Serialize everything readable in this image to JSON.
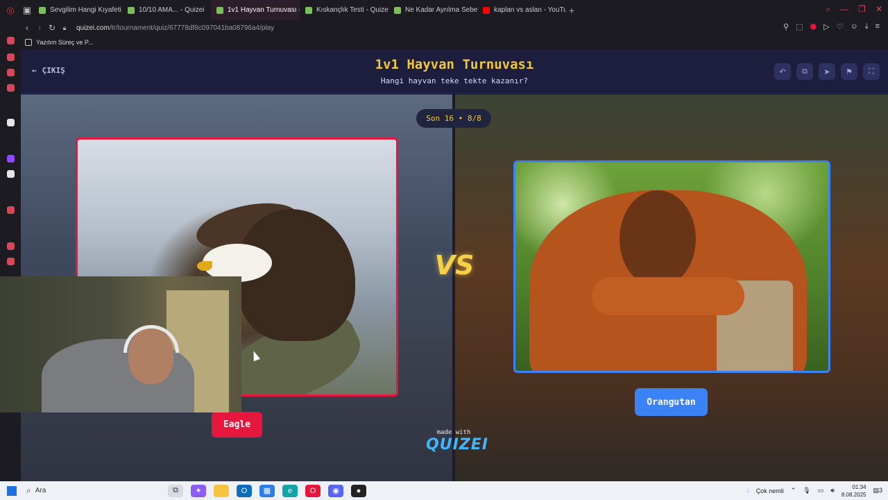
{
  "browser": {
    "tabs": [
      {
        "label": "Sevgilim Hangi Kıyafeti D",
        "color": "#7bbf5a",
        "active": false
      },
      {
        "label": "10/10 AMA... - Quizei",
        "color": "#7bbf5a",
        "active": false
      },
      {
        "label": "1v1 Hayvan Turnuvası - Q",
        "color": "#7bbf5a",
        "active": true
      },
      {
        "label": "Kıskançlık Testi - Quizei",
        "color": "#7bbf5a",
        "active": false
      },
      {
        "label": "Ne Kadar Ayrılma Sebebi",
        "color": "#7bbf5a",
        "active": false
      },
      {
        "label": "kaplan vs aslan - YouTube",
        "color": "#ff0000",
        "active": false
      }
    ],
    "url_host": "quizei.com",
    "url_path": "/tr/tournament/quiz/67778df8c097041ba08796a4/play",
    "bookmark": "Yazılım Süreç ve P..."
  },
  "header": {
    "exit_label": "ÇIKIŞ",
    "title": "1v1 Hayvan Turnuvası",
    "subtitle": "Hangi hayvan teke tekte kazanır?"
  },
  "round": "Son 16 • 8/8",
  "vs": "VS",
  "left": {
    "name": "Eagle",
    "accent": "#e5173f",
    "image": "bald eagle on branch"
  },
  "right": {
    "name": "Orangutan",
    "accent": "#3b82f6",
    "image": "orangutan leaning on post"
  },
  "made_with": {
    "label": "made with",
    "brand": "QUIZEI"
  },
  "taskbar": {
    "search_placeholder": "Ara",
    "weather": "Çok nemli",
    "time": "01:34",
    "date": "8.08.2025",
    "notifications": "3"
  }
}
